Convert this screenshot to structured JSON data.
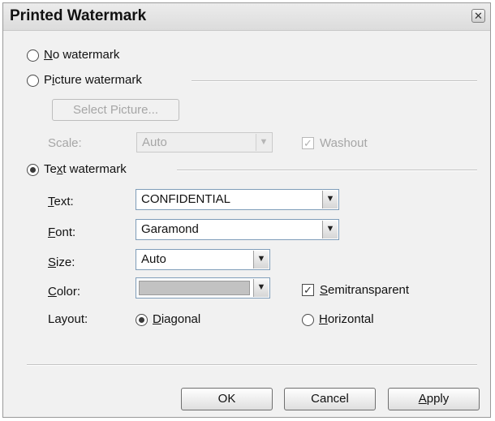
{
  "dialog": {
    "title": "Printed Watermark",
    "close_icon": "close-icon"
  },
  "no_watermark": {
    "label_accel": "N",
    "label_rest": "o watermark",
    "selected": false
  },
  "picture_watermark": {
    "label_pre": "P",
    "label_accel": "i",
    "label_rest": "cture watermark",
    "selected": false,
    "select_button": "Select Picture...",
    "scale_label": "Scale:",
    "scale_value": "Auto",
    "washout_label": "Washout",
    "washout_checked": true,
    "enabled": false
  },
  "text_watermark": {
    "label_pre": "Te",
    "label_accel": "x",
    "label_rest": "t watermark",
    "selected": true,
    "text_label_accel": "T",
    "text_label_rest": "ext:",
    "text_value": "CONFIDENTIAL",
    "font_label_accel": "F",
    "font_label_rest": "ont:",
    "font_value": "Garamond",
    "size_label_accel": "S",
    "size_label_rest": "ize:",
    "size_value": "Auto",
    "color_label_accel": "C",
    "color_label_rest": "olor:",
    "color_value": "#c2c2c2",
    "semitransparent_accel": "S",
    "semitransparent_rest": "emitransparent",
    "semitransparent_checked": true,
    "layout_label": "Layout:",
    "diagonal_accel": "D",
    "diagonal_rest": "iagonal",
    "horizontal_accel": "H",
    "horizontal_rest": "orizontal",
    "layout_selected": "Diagonal"
  },
  "buttons": {
    "ok": "OK",
    "cancel": "Cancel",
    "apply_accel": "A",
    "apply_rest": "pply"
  }
}
